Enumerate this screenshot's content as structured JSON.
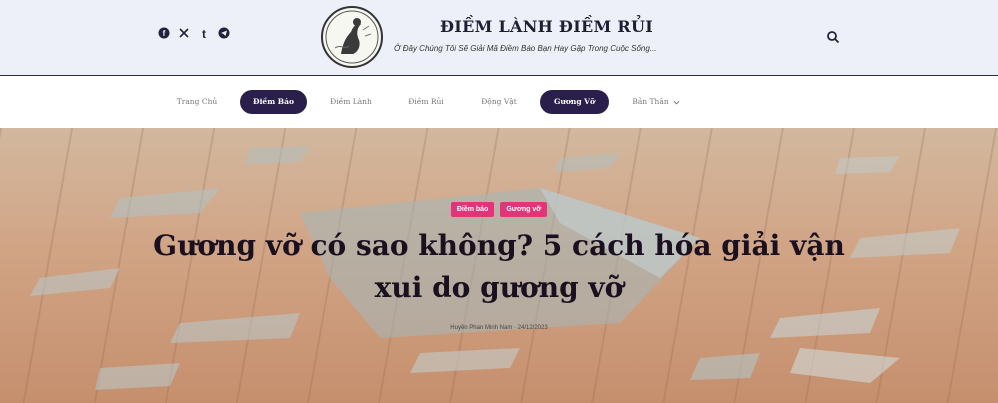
{
  "header": {
    "site_title": "ĐIỀM LÀNH ĐIỀM RỦI",
    "tagline": "Ở Đây Chúng Tôi Sẽ Giải Mã Điềm Báo Bạn Hay Gặp Trong Cuộc Sống...",
    "socials": [
      {
        "icon": "facebook-icon"
      },
      {
        "icon": "x-icon"
      },
      {
        "icon": "tumblr-icon"
      },
      {
        "icon": "telegram-icon"
      }
    ],
    "logo_icon": "logo-emblem-icon",
    "search_icon": "search-icon"
  },
  "nav": {
    "items": [
      {
        "label": "Trang Chủ",
        "active": false
      },
      {
        "label": "Điềm Báo",
        "active": true
      },
      {
        "label": "Điềm Lành",
        "active": false
      },
      {
        "label": "Điềm Rủi",
        "active": false
      },
      {
        "label": "Động Vật",
        "active": false
      },
      {
        "label": "Gương Vỡ",
        "active": true
      },
      {
        "label": "Bản Thân",
        "active": false,
        "has_dropdown": true
      }
    ]
  },
  "hero": {
    "categories": [
      "Điềm báo",
      "Gương vỡ"
    ],
    "title_line1": "Gương vỡ có sao không? 5 cách hóa giải vận",
    "title_line2": "xui do gương vỡ",
    "meta": "Huyền Phan Minh Nam · 24/12/2023"
  },
  "colors": {
    "topbar_bg": "#eef0f9",
    "nav_active_bg": "#2a1f4a",
    "chip_bg": "#e3347a",
    "title_text": "#1a1020"
  }
}
